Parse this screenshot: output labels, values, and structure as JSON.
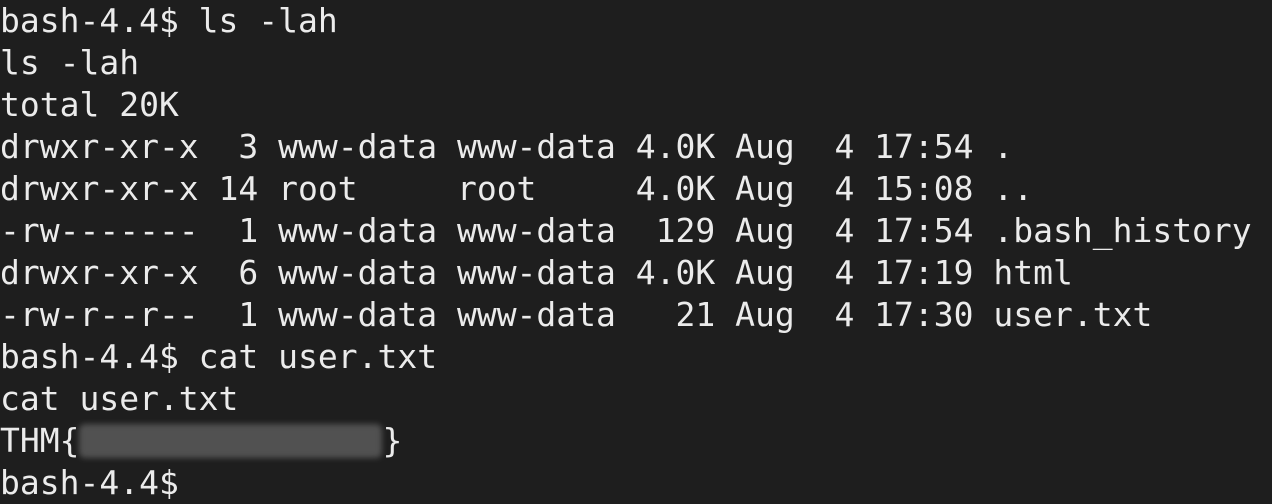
{
  "terminal": {
    "lines": [
      "bash-4.4$ ls -lah",
      "ls -lah",
      "total 20K",
      "drwxr-xr-x  3 www-data www-data 4.0K Aug  4 17:54 .",
      "drwxr-xr-x 14 root     root     4.0K Aug  4 15:08 ..",
      "-rw-------  1 www-data www-data  129 Aug  4 17:54 .bash_history",
      "drwxr-xr-x  6 www-data www-data 4.0K Aug  4 17:19 html",
      "-rw-r--r--  1 www-data www-data   21 Aug  4 17:30 user.txt",
      "bash-4.4$ cat user.txt",
      "cat user.txt"
    ],
    "flag": {
      "prefix": "THM{",
      "suffix": "}"
    },
    "final_prompt": "bash-4.4$",
    "colors": {
      "background": "#1e1e1e",
      "foreground": "#ebebeb"
    }
  }
}
